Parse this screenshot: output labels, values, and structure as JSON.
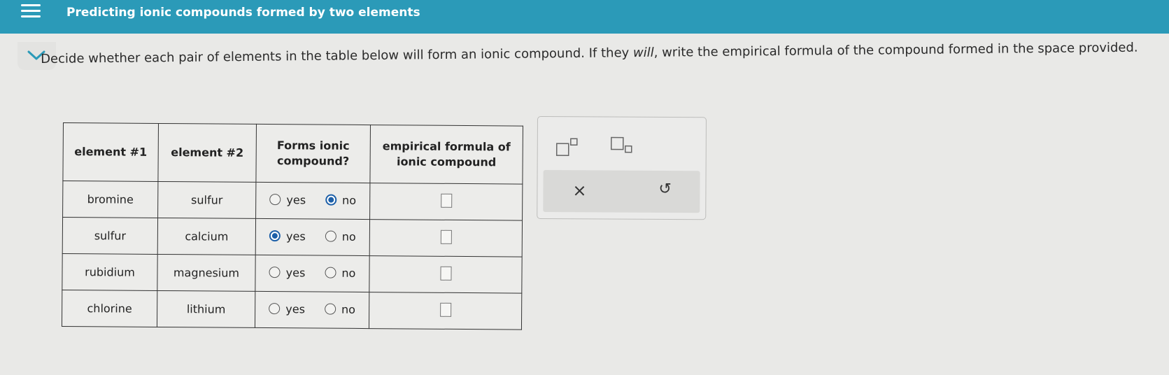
{
  "header": {
    "title": "Predicting ionic compounds formed by two elements"
  },
  "instructions": {
    "before_em": "Decide whether each pair of elements in the table below will form an ionic compound. If they ",
    "em": "will",
    "after_em": ", write the empirical formula of the compound formed in the space provided."
  },
  "table": {
    "headers": [
      "element #1",
      "element #2",
      "Forms ionic compound?",
      "empirical formula of ionic compound"
    ],
    "yes_label": "yes",
    "no_label": "no",
    "rows": [
      {
        "element1": "bromine",
        "element2": "sulfur",
        "selected": "no"
      },
      {
        "element1": "sulfur",
        "element2": "calcium",
        "selected": "yes"
      },
      {
        "element1": "rubidium",
        "element2": "magnesium",
        "selected": ""
      },
      {
        "element1": "chlorine",
        "element2": "lithium",
        "selected": ""
      }
    ]
  },
  "palette": {
    "buttons": [
      "superscript-icon",
      "subscript-icon"
    ],
    "clear_glyph": "×",
    "undo_glyph": "↺"
  },
  "colors": {
    "header_bar": "#2b9ab8",
    "radio_selected": "#1c5fa8"
  }
}
